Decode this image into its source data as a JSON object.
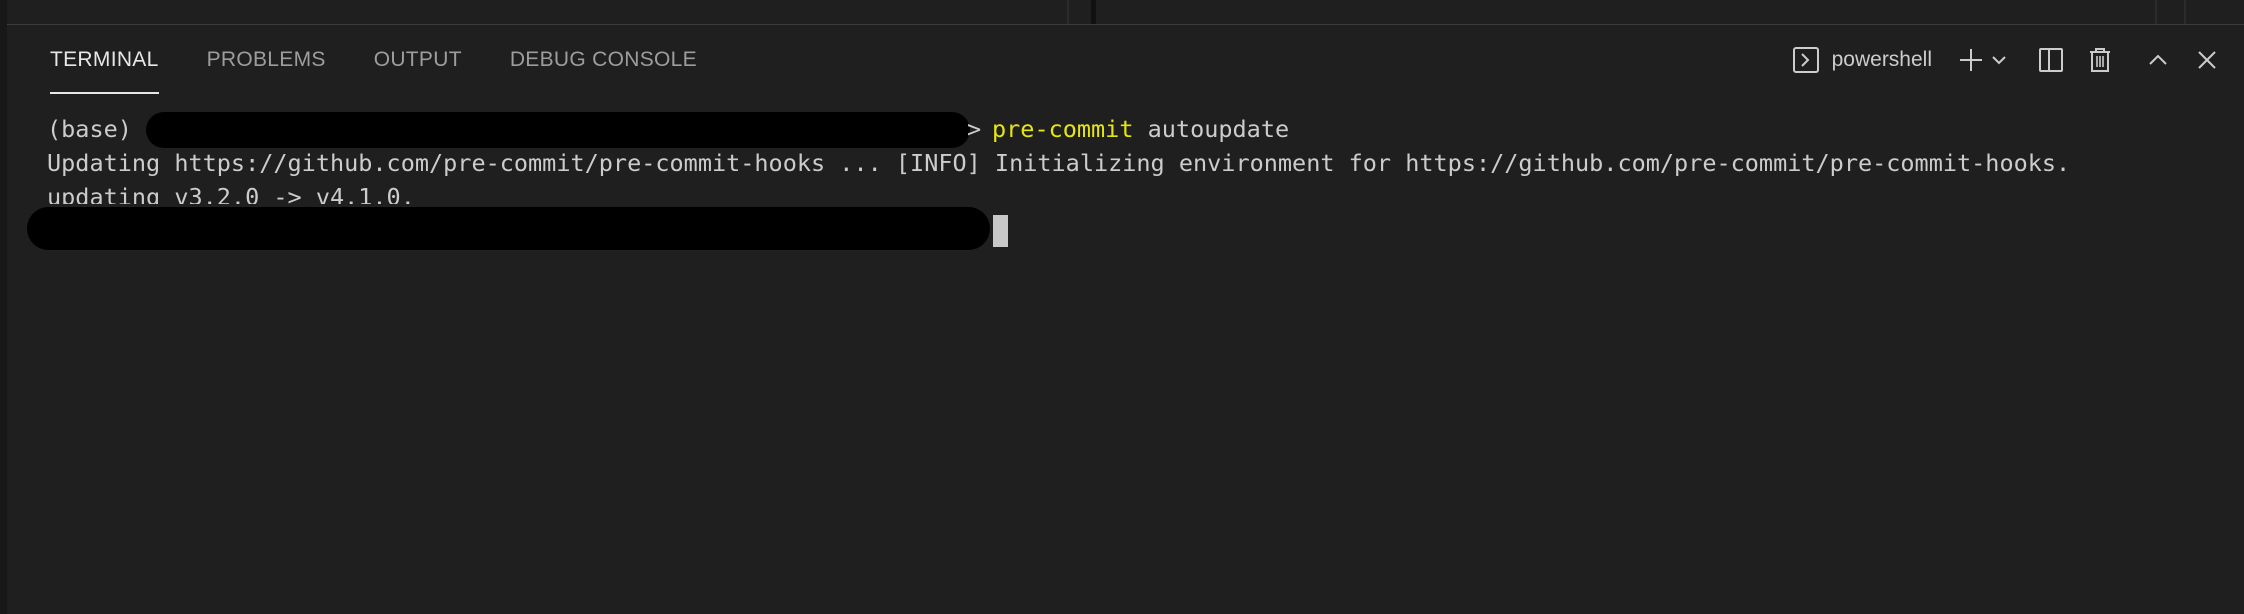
{
  "panel": {
    "tabs": [
      {
        "label": "TERMINAL",
        "active": true
      },
      {
        "label": "PROBLEMS",
        "active": false
      },
      {
        "label": "OUTPUT",
        "active": false
      },
      {
        "label": "DEBUG CONSOLE",
        "active": false
      }
    ],
    "shell_label": "powershell",
    "icons": {
      "shell": "terminal-icon",
      "new": "plus-icon",
      "dropdown": "chevron-down-icon",
      "split": "split-icon",
      "kill": "trash-icon",
      "maximize": "chevron-up-icon",
      "close": "close-icon"
    }
  },
  "terminal": {
    "prompt_prefix": "(base)",
    "prompt_symbol": ">",
    "command_name": "pre-commit",
    "command_args": "autoupdate",
    "output_line_1": "Updating https://github.com/pre-commit/pre-commit-hooks ... [INFO] Initializing environment for https://github.com/pre-commit/pre-commit-hooks.",
    "output_line_2": "updating v3.2.0 -> v4.1.0."
  },
  "colors": {
    "background": "#1f1f1f",
    "text": "#cccccc",
    "command_highlight": "#e5e510",
    "active_tab": "#e7e7e7",
    "inactive_tab": "#9d9d9d"
  }
}
